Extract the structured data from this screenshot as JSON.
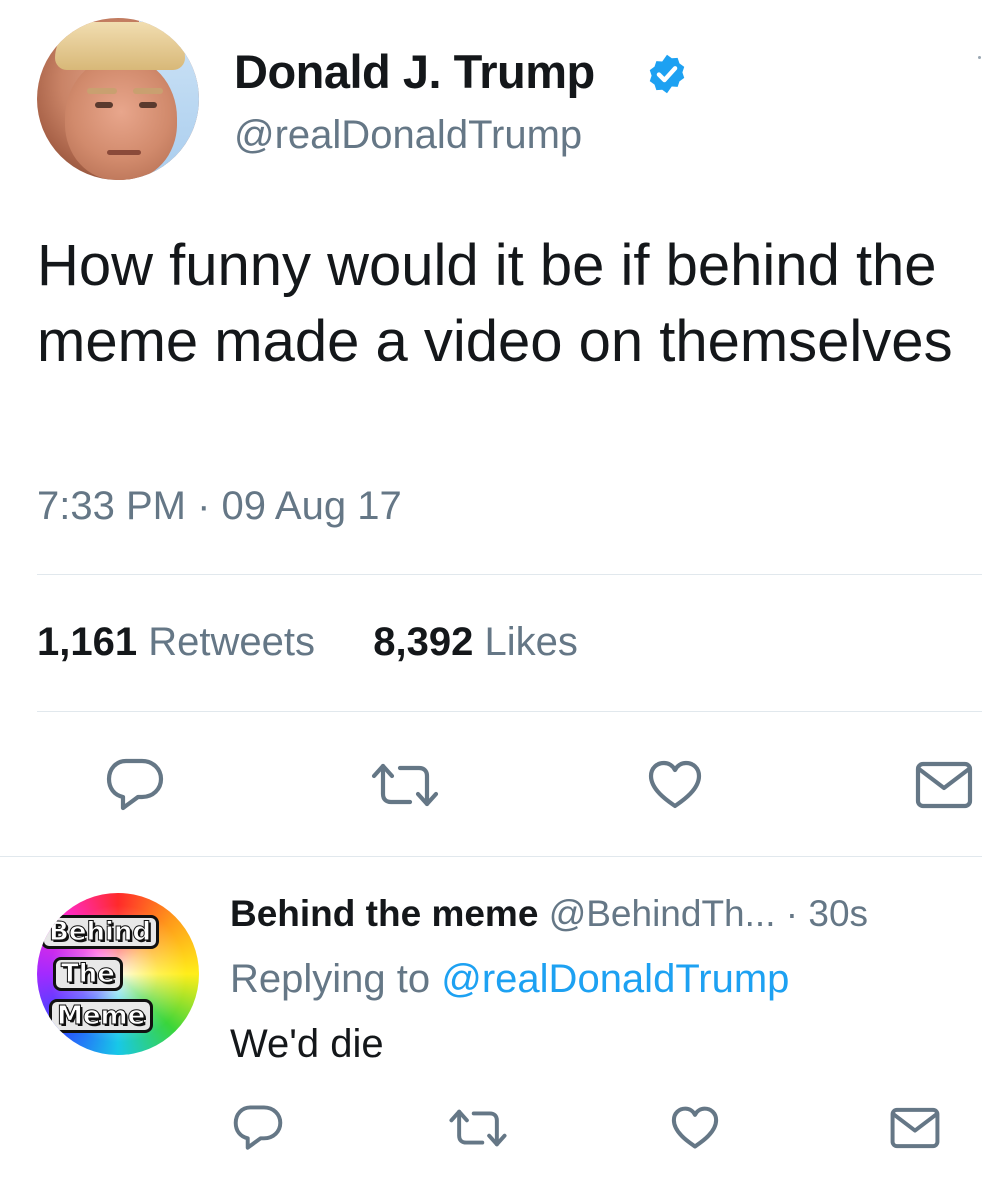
{
  "main_tweet": {
    "display_name": "Donald J. Trump",
    "handle": "@realDonaldTrump",
    "text": "How funny would it be if behind the meme made a video on themselves",
    "timestamp": "7:33 PM · 09 Aug 17",
    "retweets_count": "1,161",
    "retweets_label": "Retweets",
    "likes_count": "8,392",
    "likes_label": "Likes",
    "verified_icon": "verified-badge",
    "actions": [
      "reply-icon",
      "retweet-icon",
      "like-icon",
      "message-icon"
    ]
  },
  "reply": {
    "display_name": "Behind the meme",
    "handle": "@BehindTh...",
    "time": "· 30s",
    "replying_to_prefix": "Replying to",
    "replying_to_user": "@realDonaldTrump",
    "text": "We'd die",
    "avatar_logo": {
      "line1": "Behind",
      "line2": "The",
      "line3": "Meme"
    },
    "actions": [
      "reply-icon",
      "retweet-icon",
      "like-icon",
      "message-icon"
    ]
  },
  "colors": {
    "text_primary": "#14171a",
    "text_secondary": "#657786",
    "link": "#1da1f2",
    "verified": "#1da1f2",
    "divider": "#e1e8ed"
  }
}
